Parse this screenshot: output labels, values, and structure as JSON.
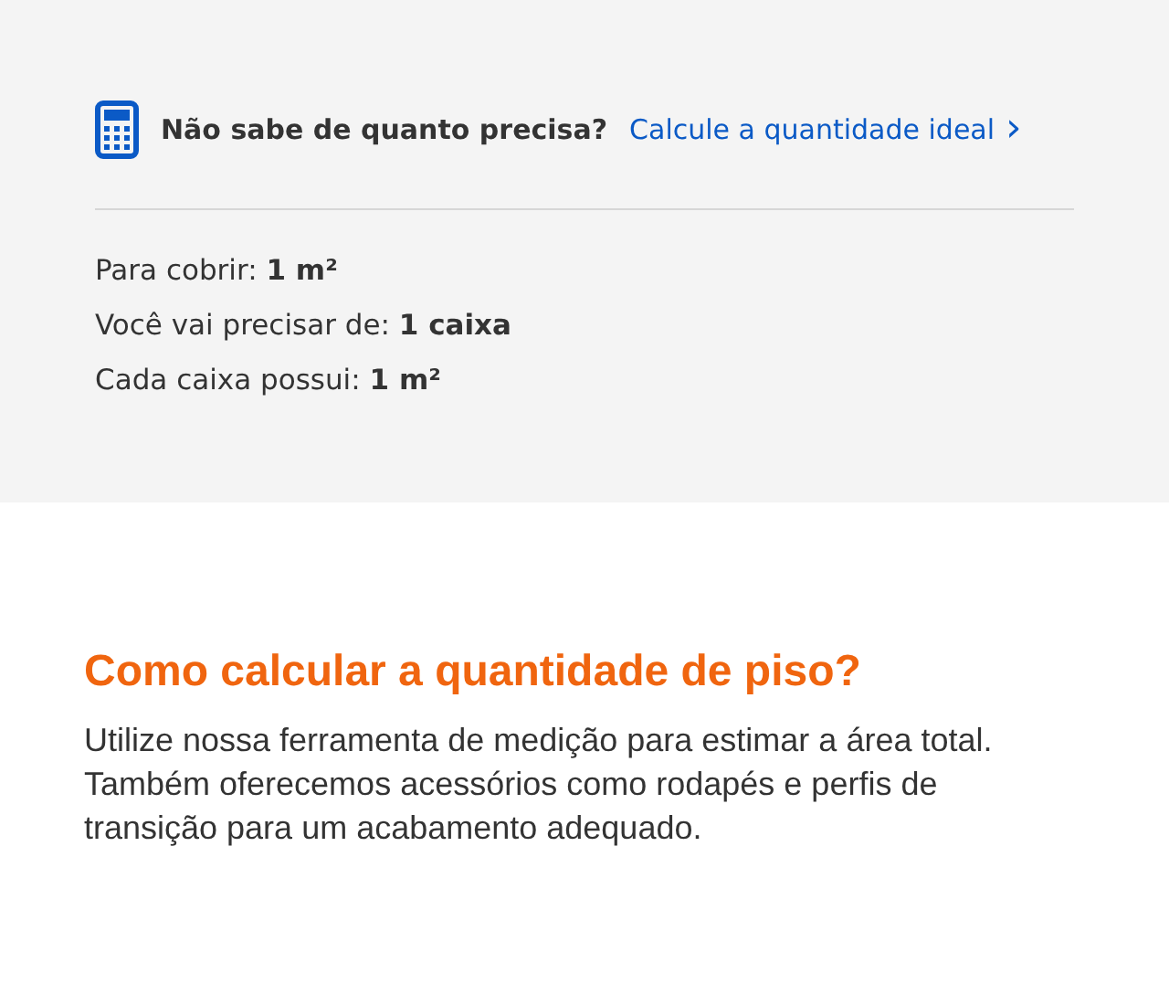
{
  "calculator": {
    "question": "Não sabe de quanto precisa?",
    "link": "Calcule a quantidade ideal",
    "chevron": "›"
  },
  "summary": [
    "Para cobrir: **1 m²**",
    "Você vai precisar de: **1 caixa**",
    "Cada caixa possui: **1 m²**"
  ],
  "info": {
    "heading": "Como calcular a quantidade de piso?",
    "text": "Utilize nossa ferramenta de medição para estimar a área total. Também oferecemos acessórios como rodapés e perfis de transição para um acabamento adequado."
  }
}
